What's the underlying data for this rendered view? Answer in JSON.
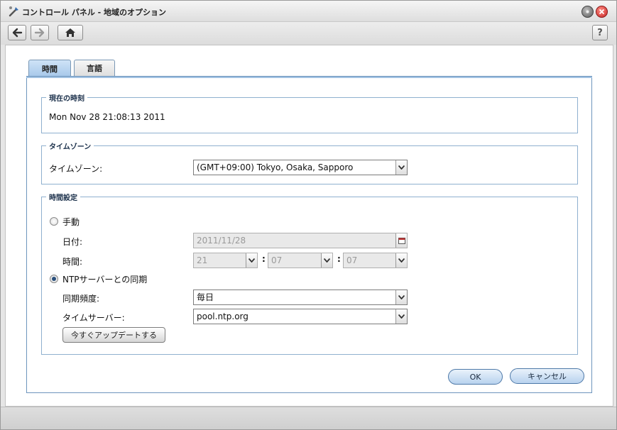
{
  "window": {
    "title": "コントロール パネル - 地域のオプション"
  },
  "toolbar": {
    "help_label": "?"
  },
  "tabs": [
    {
      "label": "時間",
      "active": true
    },
    {
      "label": "言語",
      "active": false
    }
  ],
  "current_time": {
    "legend": "現在の時刻",
    "value": "Mon Nov 28 21:08:13 2011"
  },
  "timezone": {
    "legend": "タイムゾーン",
    "label": "タイムゾーン:",
    "value": "(GMT+09:00) Tokyo, Osaka, Sapporo"
  },
  "time_settings": {
    "legend": "時間設定",
    "manual": {
      "label": "手動",
      "checked": false,
      "date_label": "日付:",
      "date_value": "2011/11/28",
      "time_label": "時間:",
      "hour": "21",
      "minute": "07",
      "second": "07",
      "separator": ":"
    },
    "ntp": {
      "label": "NTPサーバーとの同期",
      "checked": true,
      "frequency_label": "同期頻度:",
      "frequency_value": "毎日",
      "server_label": "タイムサーバー:",
      "server_value": "pool.ntp.org",
      "update_button": "今すぐアップデートする"
    }
  },
  "footer": {
    "ok_label": "OK",
    "cancel_label": "キャンセル"
  },
  "colors": {
    "accent": "#6d95bd",
    "tab_active": "#a7c8ea",
    "close": "#c62828"
  },
  "icons": [
    "app-icon",
    "back-icon",
    "forward-icon",
    "home-icon",
    "help-icon",
    "minimize-icon",
    "close-icon",
    "calendar-icon",
    "chevron-down-icon"
  ]
}
